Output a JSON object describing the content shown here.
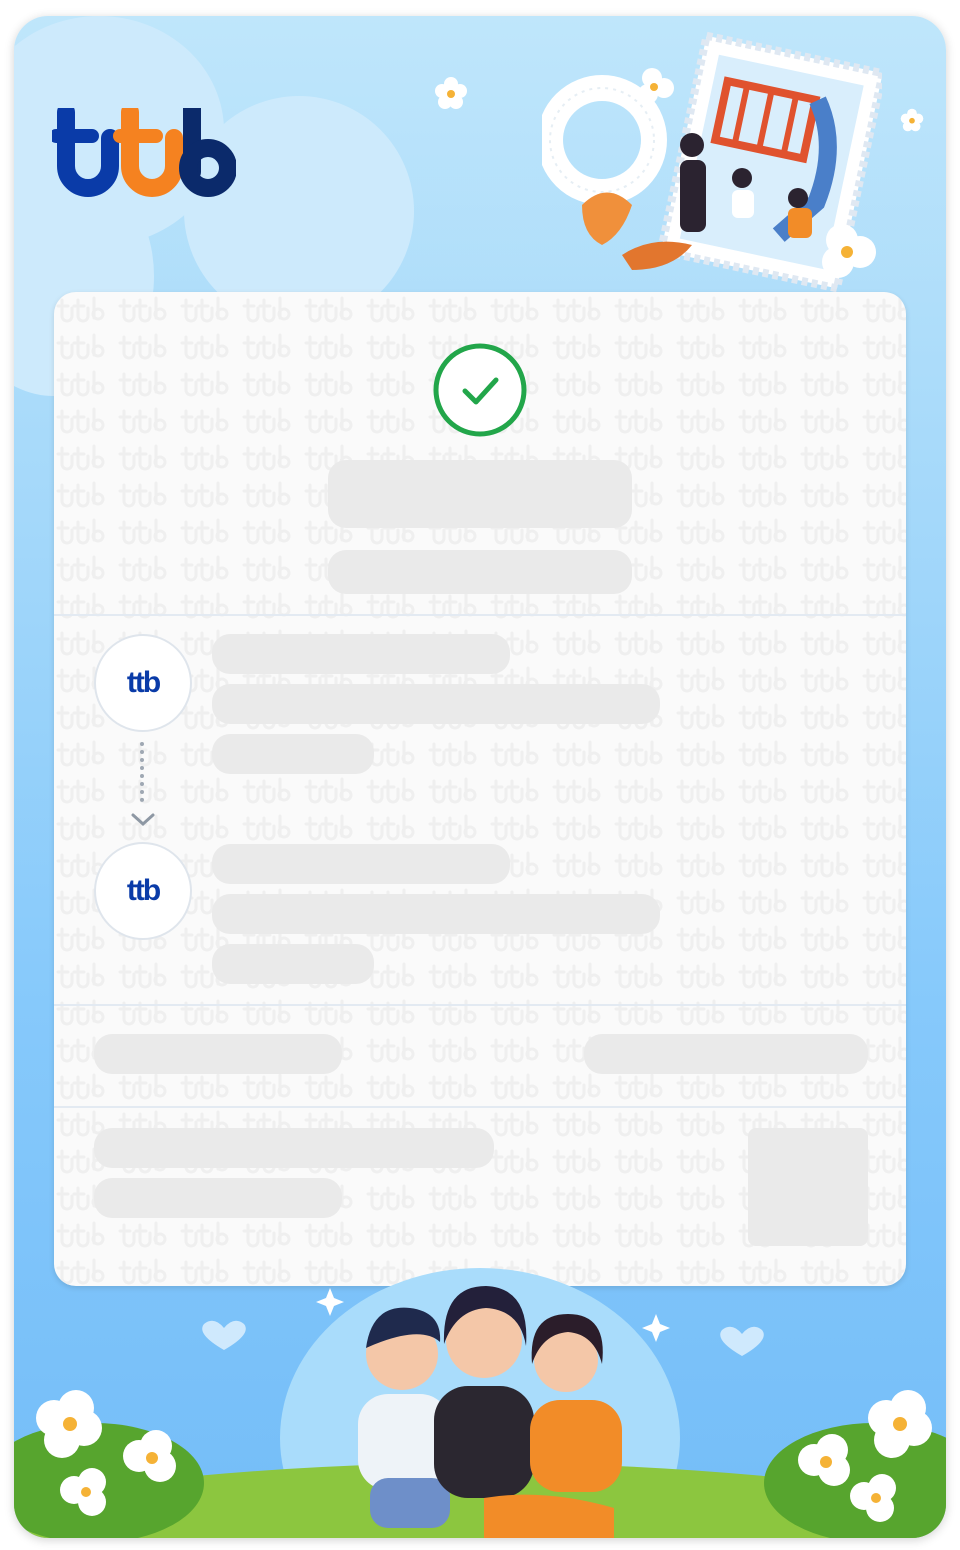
{
  "brand": {
    "name": "ttb",
    "colors": {
      "dark_blue": "#0a3ba8",
      "orange": "#f58220",
      "navy": "#0b2a6b"
    }
  },
  "header": {
    "logo_text": "ttb"
  },
  "slip": {
    "status_icon": "check-circle-icon",
    "status_color": "#22a64a",
    "sender": {
      "avatar_text": "ttb"
    },
    "receiver": {
      "avatar_text": "ttb"
    },
    "arrow_icon": "chevron-down-icon"
  },
  "decorations": {
    "top_illustration": "family-playground-stamp",
    "bottom_illustration": "family-jasmine-garden"
  }
}
